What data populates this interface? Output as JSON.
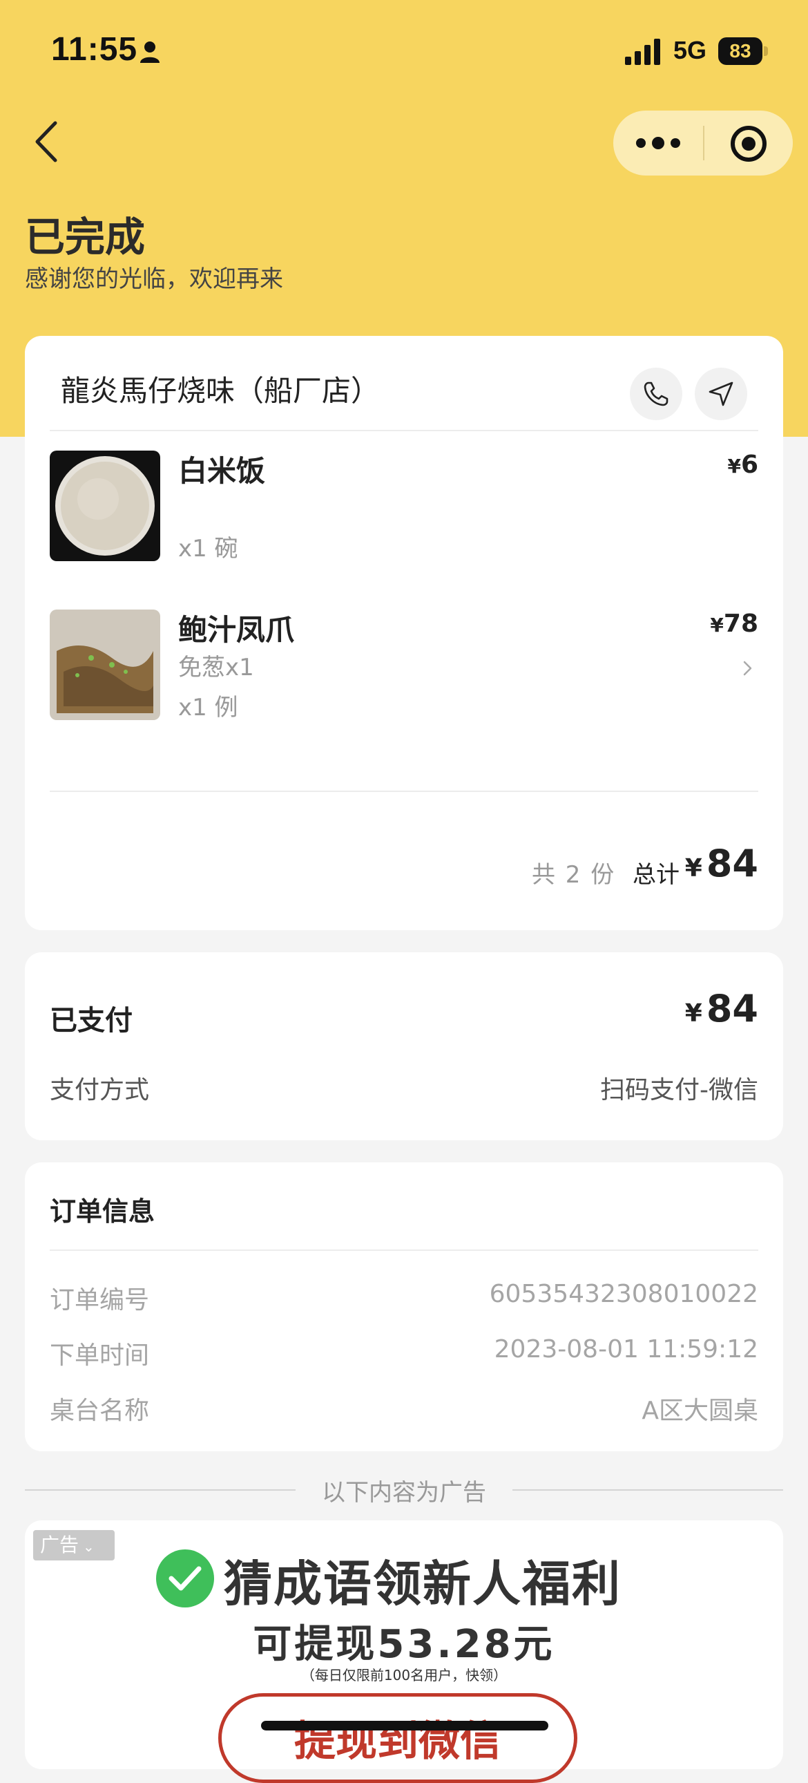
{
  "status_bar": {
    "time": "11:55",
    "network": "5G",
    "battery": "83"
  },
  "header": {
    "title": "已完成",
    "subtitle": "感谢您的光临，欢迎再来"
  },
  "store": {
    "name": "龍炎馬仔烧味（船厂店）"
  },
  "items": [
    {
      "name": "白米饭",
      "price_symbol": "¥",
      "price": "6",
      "spec": "",
      "qty": "x1 碗"
    },
    {
      "name": "鲍汁凤爪",
      "price_symbol": "¥",
      "price": "78",
      "spec": "免葱x1",
      "qty": "x1 例"
    }
  ],
  "summary": {
    "count": "共 2 份",
    "total_label": "总计",
    "currency": "¥",
    "total": "84"
  },
  "payment": {
    "status": "已支付",
    "currency": "¥",
    "amount": "84",
    "method_label": "支付方式",
    "method_value": "扫码支付-微信"
  },
  "order_info": {
    "title": "订单信息",
    "rows": [
      {
        "label": "订单编号",
        "value": "60535432308010022"
      },
      {
        "label": "下单时间",
        "value": "2023-08-01 11:59:12"
      },
      {
        "label": "桌台名称",
        "value": "A区大圆桌"
      }
    ]
  },
  "ad": {
    "divider_text": "以下内容为广告",
    "badge": "广告",
    "headline": "猜成语领新人福利",
    "subline": "可提现53.28元",
    "note": "（每日仅限前100名用户，快领）",
    "cta": "提现到微信"
  },
  "colors": {
    "header_bg": "#f7d55f",
    "capsule_bg": "#fbecb4",
    "check_green": "#3fbf5a",
    "cta_red": "#c0392b"
  }
}
